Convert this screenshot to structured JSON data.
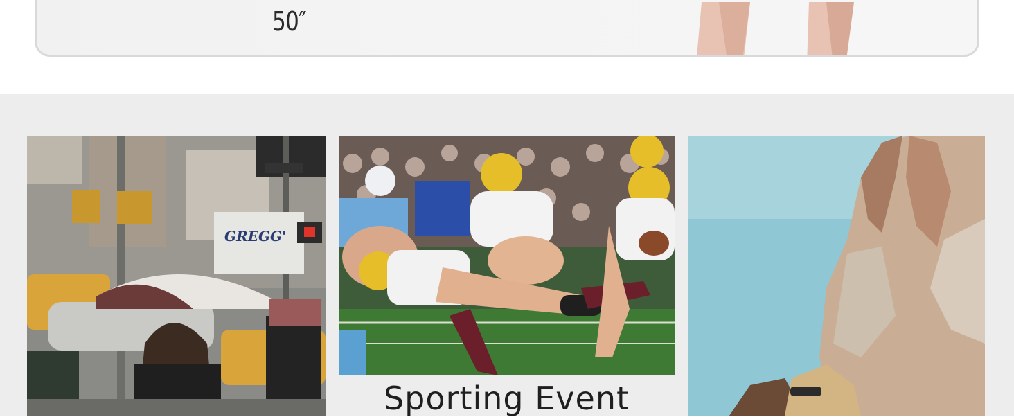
{
  "size_card": {
    "size_label": "50″"
  },
  "gallery": {
    "tiles": [
      {
        "image": "rainy-street-photo",
        "caption": ""
      },
      {
        "image": "football-game-photo",
        "caption": "Sporting Event"
      },
      {
        "image": "rock-mountain-photo",
        "caption": ""
      }
    ]
  },
  "colors": {
    "page_bg": "#ffffff",
    "section_bg": "#ededed",
    "card_border": "#d9d9d9"
  }
}
